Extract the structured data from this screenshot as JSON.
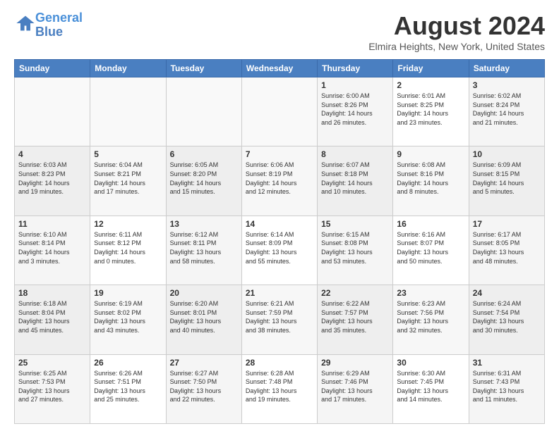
{
  "header": {
    "logo_line1": "General",
    "logo_line2": "Blue",
    "month": "August 2024",
    "location": "Elmira Heights, New York, United States"
  },
  "weekdays": [
    "Sunday",
    "Monday",
    "Tuesday",
    "Wednesday",
    "Thursday",
    "Friday",
    "Saturday"
  ],
  "weeks": [
    [
      {
        "day": "",
        "info": ""
      },
      {
        "day": "",
        "info": ""
      },
      {
        "day": "",
        "info": ""
      },
      {
        "day": "",
        "info": ""
      },
      {
        "day": "1",
        "info": "Sunrise: 6:00 AM\nSunset: 8:26 PM\nDaylight: 14 hours\nand 26 minutes."
      },
      {
        "day": "2",
        "info": "Sunrise: 6:01 AM\nSunset: 8:25 PM\nDaylight: 14 hours\nand 23 minutes."
      },
      {
        "day": "3",
        "info": "Sunrise: 6:02 AM\nSunset: 8:24 PM\nDaylight: 14 hours\nand 21 minutes."
      }
    ],
    [
      {
        "day": "4",
        "info": "Sunrise: 6:03 AM\nSunset: 8:23 PM\nDaylight: 14 hours\nand 19 minutes."
      },
      {
        "day": "5",
        "info": "Sunrise: 6:04 AM\nSunset: 8:21 PM\nDaylight: 14 hours\nand 17 minutes."
      },
      {
        "day": "6",
        "info": "Sunrise: 6:05 AM\nSunset: 8:20 PM\nDaylight: 14 hours\nand 15 minutes."
      },
      {
        "day": "7",
        "info": "Sunrise: 6:06 AM\nSunset: 8:19 PM\nDaylight: 14 hours\nand 12 minutes."
      },
      {
        "day": "8",
        "info": "Sunrise: 6:07 AM\nSunset: 8:18 PM\nDaylight: 14 hours\nand 10 minutes."
      },
      {
        "day": "9",
        "info": "Sunrise: 6:08 AM\nSunset: 8:16 PM\nDaylight: 14 hours\nand 8 minutes."
      },
      {
        "day": "10",
        "info": "Sunrise: 6:09 AM\nSunset: 8:15 PM\nDaylight: 14 hours\nand 5 minutes."
      }
    ],
    [
      {
        "day": "11",
        "info": "Sunrise: 6:10 AM\nSunset: 8:14 PM\nDaylight: 14 hours\nand 3 minutes."
      },
      {
        "day": "12",
        "info": "Sunrise: 6:11 AM\nSunset: 8:12 PM\nDaylight: 14 hours\nand 0 minutes."
      },
      {
        "day": "13",
        "info": "Sunrise: 6:12 AM\nSunset: 8:11 PM\nDaylight: 13 hours\nand 58 minutes."
      },
      {
        "day": "14",
        "info": "Sunrise: 6:14 AM\nSunset: 8:09 PM\nDaylight: 13 hours\nand 55 minutes."
      },
      {
        "day": "15",
        "info": "Sunrise: 6:15 AM\nSunset: 8:08 PM\nDaylight: 13 hours\nand 53 minutes."
      },
      {
        "day": "16",
        "info": "Sunrise: 6:16 AM\nSunset: 8:07 PM\nDaylight: 13 hours\nand 50 minutes."
      },
      {
        "day": "17",
        "info": "Sunrise: 6:17 AM\nSunset: 8:05 PM\nDaylight: 13 hours\nand 48 minutes."
      }
    ],
    [
      {
        "day": "18",
        "info": "Sunrise: 6:18 AM\nSunset: 8:04 PM\nDaylight: 13 hours\nand 45 minutes."
      },
      {
        "day": "19",
        "info": "Sunrise: 6:19 AM\nSunset: 8:02 PM\nDaylight: 13 hours\nand 43 minutes."
      },
      {
        "day": "20",
        "info": "Sunrise: 6:20 AM\nSunset: 8:01 PM\nDaylight: 13 hours\nand 40 minutes."
      },
      {
        "day": "21",
        "info": "Sunrise: 6:21 AM\nSunset: 7:59 PM\nDaylight: 13 hours\nand 38 minutes."
      },
      {
        "day": "22",
        "info": "Sunrise: 6:22 AM\nSunset: 7:57 PM\nDaylight: 13 hours\nand 35 minutes."
      },
      {
        "day": "23",
        "info": "Sunrise: 6:23 AM\nSunset: 7:56 PM\nDaylight: 13 hours\nand 32 minutes."
      },
      {
        "day": "24",
        "info": "Sunrise: 6:24 AM\nSunset: 7:54 PM\nDaylight: 13 hours\nand 30 minutes."
      }
    ],
    [
      {
        "day": "25",
        "info": "Sunrise: 6:25 AM\nSunset: 7:53 PM\nDaylight: 13 hours\nand 27 minutes."
      },
      {
        "day": "26",
        "info": "Sunrise: 6:26 AM\nSunset: 7:51 PM\nDaylight: 13 hours\nand 25 minutes."
      },
      {
        "day": "27",
        "info": "Sunrise: 6:27 AM\nSunset: 7:50 PM\nDaylight: 13 hours\nand 22 minutes."
      },
      {
        "day": "28",
        "info": "Sunrise: 6:28 AM\nSunset: 7:48 PM\nDaylight: 13 hours\nand 19 minutes."
      },
      {
        "day": "29",
        "info": "Sunrise: 6:29 AM\nSunset: 7:46 PM\nDaylight: 13 hours\nand 17 minutes."
      },
      {
        "day": "30",
        "info": "Sunrise: 6:30 AM\nSunset: 7:45 PM\nDaylight: 13 hours\nand 14 minutes."
      },
      {
        "day": "31",
        "info": "Sunrise: 6:31 AM\nSunset: 7:43 PM\nDaylight: 13 hours\nand 11 minutes."
      }
    ]
  ]
}
